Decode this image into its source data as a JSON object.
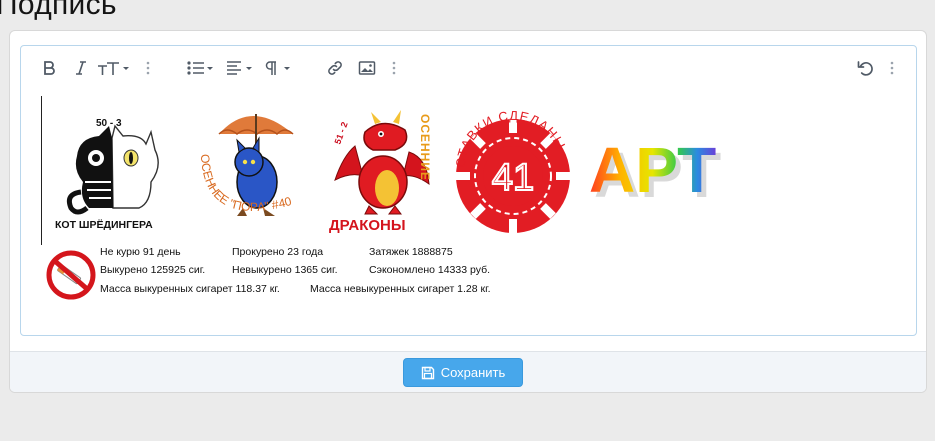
{
  "page": {
    "heading": "Подпись"
  },
  "toolbar": {
    "icons": [
      "bold-icon",
      "italic-icon",
      "text-size-icon",
      "more-vertical-icon",
      "list-icon",
      "align-icon",
      "paragraph-icon",
      "more-vertical-icon",
      "link-icon",
      "image-icon",
      "more-vertical-icon",
      "undo-icon",
      "more-vertical-icon"
    ]
  },
  "signature": {
    "images": [
      {
        "name": "cat-skeleton",
        "caption": "КОТ ШРЁДИНГЕРА",
        "top_text": "50 - 3"
      },
      {
        "name": "blue-cat-umbrella",
        "caption_arc": "ОСЕННЕЕ \"ПОРА\" #40"
      },
      {
        "name": "red-dragon",
        "caption": "ДРАКОНЫ",
        "vertical_text": "ОСЕННИЕ",
        "top_text": "51 - 2"
      },
      {
        "name": "poker-chip",
        "number": "41",
        "arc_text": "СТАВКИ СДЕЛАНЫ"
      },
      {
        "name": "art-logo",
        "text": "АРТ"
      }
    ],
    "stats": {
      "not_smoking": "Не курю 91 день",
      "smoked_away": "Прокурено 23 года",
      "puffs": "Затяжек 1888875",
      "smoked_cigs": "Выкурено 125925 сиг.",
      "not_smoked_cigs": "Невыкурено 1365 сиг.",
      "saved": "Сэкономлено 14333 руб.",
      "mass_smoked": "Масса выкуренных сигарет 118.37 кг.",
      "mass_not_smoked": "Масса невыкуренных сигарет 1.28 кг."
    }
  },
  "footer": {
    "save_label": "Сохранить"
  },
  "colors": {
    "accent": "#47a7eb",
    "editor_border": "#b8d6ec"
  }
}
